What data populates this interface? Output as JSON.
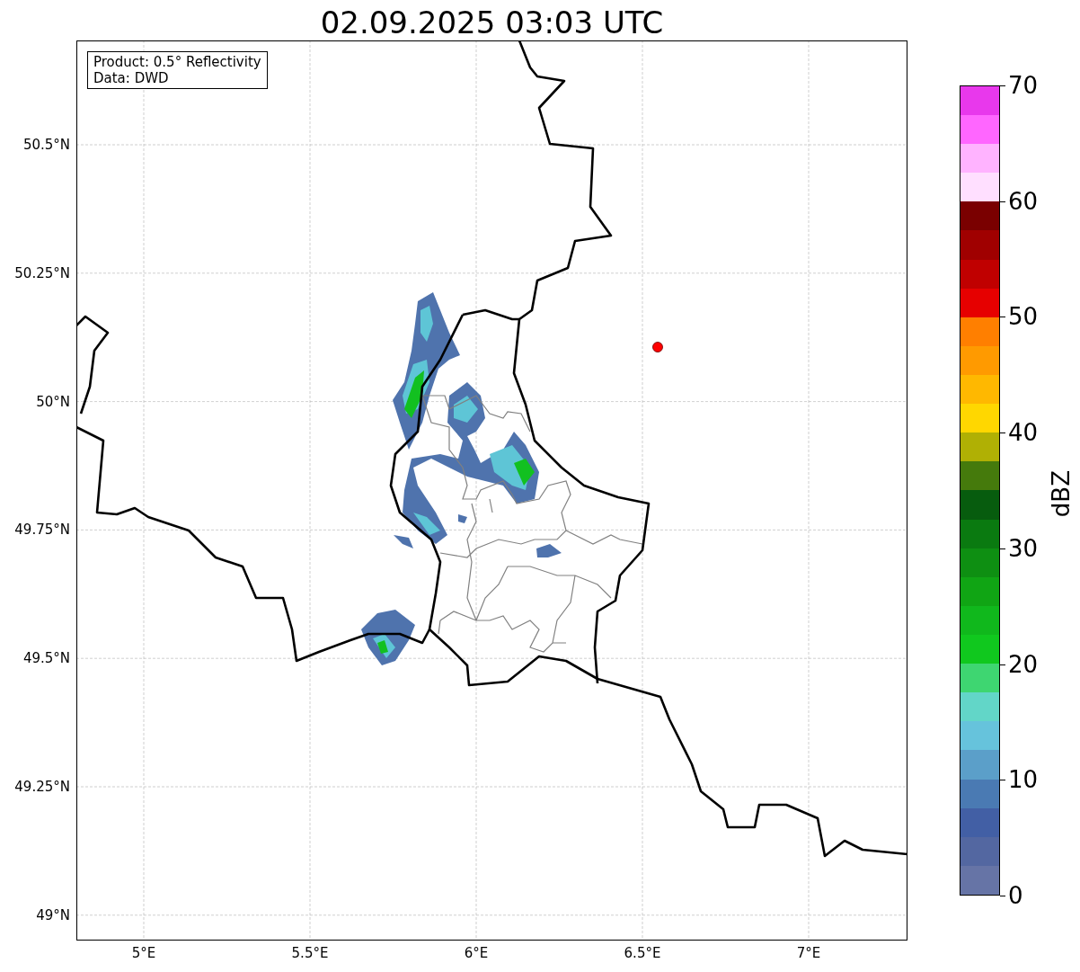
{
  "title": "02.09.2025 03:03 UTC",
  "legend": [
    "Product: 0.5° Reflectivity",
    "Data: DWD"
  ],
  "y_ticks": [
    "50.5°N",
    "50.25°N",
    "50°N",
    "49.75°N",
    "49.5°N",
    "49.25°N",
    "49°N"
  ],
  "x_ticks": [
    "5°E",
    "5.5°E",
    "6°E",
    "6.5°E",
    "7°E"
  ],
  "colorbar": {
    "label": "dBZ",
    "ticks": [
      "70",
      "60",
      "50",
      "40",
      "30",
      "20",
      "10",
      "0"
    ],
    "bins": [
      {
        "color": "#6674a6"
      },
      {
        "color": "#5367a1"
      },
      {
        "color": "#425fa5"
      },
      {
        "color": "#4a7ab3"
      },
      {
        "color": "#5b9fc9"
      },
      {
        "color": "#66c3dc"
      },
      {
        "color": "#62d6c8"
      },
      {
        "color": "#3ed671"
      },
      {
        "color": "#10c81e"
      },
      {
        "color": "#10b81c"
      },
      {
        "color": "#10a514"
      },
      {
        "color": "#0e8f12"
      },
      {
        "color": "#0a7a10"
      },
      {
        "color": "#075c0e"
      },
      {
        "color": "#457a0c"
      },
      {
        "color": "#b0b004"
      },
      {
        "color": "#ffd700"
      },
      {
        "color": "#ffb800"
      },
      {
        "color": "#ff9a00"
      },
      {
        "color": "#ff7f00"
      },
      {
        "color": "#e60000"
      },
      {
        "color": "#c00000"
      },
      {
        "color": "#a00000"
      },
      {
        "color": "#7a0000"
      },
      {
        "color": "#ffdfff"
      },
      {
        "color": "#ffb3ff"
      },
      {
        "color": "#ff66ff"
      },
      {
        "color": "#e838ec"
      }
    ]
  }
}
